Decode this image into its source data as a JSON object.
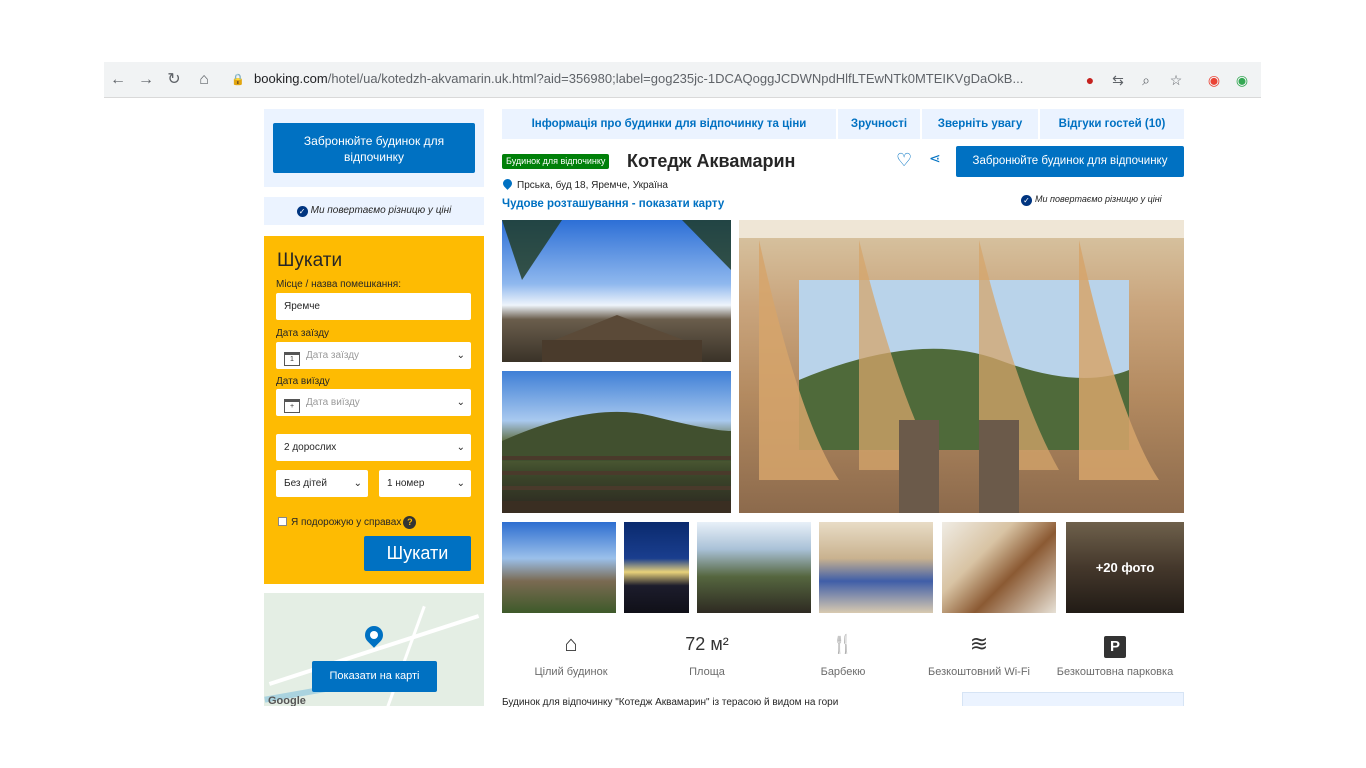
{
  "browser": {
    "url_domain": "booking.com",
    "url_path": "/hotel/ua/kotedzh-akvamarin.uk.html?aid=356980;label=gog235jc-1DCAQoggJCDWNpdHlfLTEwNTk0MTEIKVgDaOkB..."
  },
  "left": {
    "book_button": "Забронюйте будинок для відпочинку",
    "price_match": "Ми повертаємо різницю у ціні",
    "search": {
      "title": "Шукати",
      "destination_label": "Місце / назва помешкання:",
      "destination_value": "Яремче",
      "checkin_label": "Дата заїзду",
      "checkin_placeholder": "Дата заїзду",
      "checkout_label": "Дата виїзду",
      "checkout_placeholder": "Дата виїзду",
      "adults": "2 дорослих",
      "children": "Без дітей",
      "rooms": "1 номер",
      "work_trip": "Я подорожую у справах",
      "submit": "Шукати"
    },
    "map_button": "Показати на карті",
    "map_google": "Google"
  },
  "tabs": [
    "Інформація про будинки для відпочинку та ціни",
    "Зручності",
    "Зверніть увагу",
    "Відгуки гостей (10)"
  ],
  "property": {
    "type_badge": "Будинок для відпочинку",
    "name": "Котедж Аквамарин",
    "book_button": "Забронюйте будинок для відпочинку",
    "address": "Прська, буд 18, Яремче, Україна",
    "location_link": "Чудове розташування - показати карту",
    "price_match": "Ми повертаємо різницю у ціні",
    "more_photos": "+20 фото"
  },
  "facilities": [
    {
      "icon": "house-icon",
      "glyph": "⌂",
      "label": "Цілий будинок"
    },
    {
      "icon": "area-icon",
      "glyph": "72 м²",
      "label": "Площа"
    },
    {
      "icon": "bbq-icon",
      "glyph": "🍴",
      "label": "Барбекю"
    },
    {
      "icon": "wifi-icon",
      "glyph": "≋",
      "label": "Безкоштовний Wi-Fi"
    },
    {
      "icon": "parking-icon",
      "glyph": "P",
      "label": "Безкоштовна парковка"
    }
  ],
  "description_start": "Будинок для відпочинку \"Котедж Аквамарин\" із терасою й видом на гори"
}
